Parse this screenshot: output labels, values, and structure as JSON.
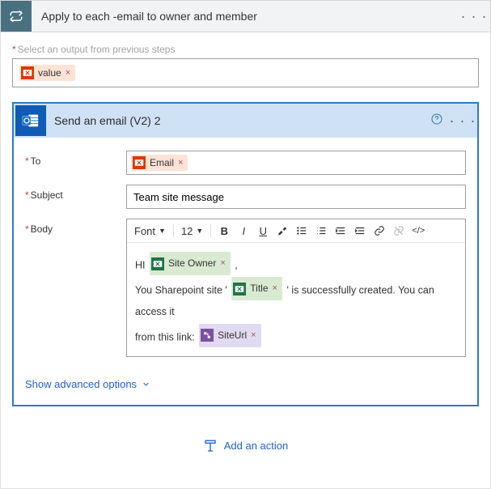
{
  "loop": {
    "title": "Apply to each -email to owner and member",
    "output_label": "Select an output from previous steps",
    "output_token": "value"
  },
  "action": {
    "title": "Send an email (V2) 2",
    "labels": {
      "to": "To",
      "subject": "Subject",
      "body": "Body"
    },
    "to_token": "Email",
    "subject": "Team site message",
    "rte": {
      "font": "Font",
      "size": "12"
    },
    "body": {
      "t_hi": "HI",
      "tk_owner": "Site Owner",
      "t_comma": ",",
      "t_line2a": "You Sharepoint site '",
      "tk_title": "Title",
      "t_line2b": "' is successfully created. You can access it",
      "t_line3a": "from this link:",
      "tk_url": "SiteUrl"
    },
    "advanced": "Show advanced options",
    "add_action": "Add an action"
  }
}
